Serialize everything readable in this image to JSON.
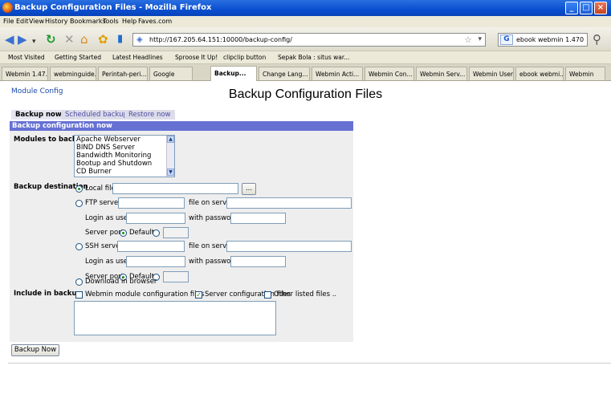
{
  "window": {
    "title": "Backup Configuration Files - Mozilla Firefox"
  },
  "menu": [
    "File",
    "Edit",
    "View",
    "History",
    "Bookmarks",
    "Tools",
    "Help",
    "Faves.com"
  ],
  "navbar": {
    "url": "http://167.205.64.151:10000/backup-config/",
    "search_value": "ebook webmin 1.470"
  },
  "bookmarks": [
    "Most Visited",
    "Getting Started",
    "Latest Headlines",
    "Sproose It Up!",
    "clipclip button",
    "Sepak Bola : situs war..."
  ],
  "tabs": [
    "Webmin 1.47...",
    "webminguide...",
    "Perintah-peri...",
    "Google",
    "Backup...",
    "Change Lang...",
    "Webmin Acti...",
    "Webmin Con...",
    "Webmin Serv...",
    "Webmin Users",
    "ebook webmi...",
    "Webmin"
  ],
  "page": {
    "module_config": "Module Config",
    "title": "Backup Configuration Files",
    "page_tabs": [
      "Backup now",
      "Scheduled backups",
      "Restore now"
    ],
    "panel_header": "Backup configuration now",
    "modules_label": "Modules to backup",
    "modules": [
      "Apache Webserver",
      "BIND DNS Server",
      "Bandwidth Monitoring",
      "Bootup and Shutdown",
      "CD Burner"
    ],
    "destination_label": "Backup destination",
    "local_file": "Local file",
    "browse": "...",
    "ftp_server": "FTP server",
    "file_on_server": "file on server",
    "login_as_user": "Login as user",
    "with_password": "with password",
    "server_port": "Server port",
    "default": "Default",
    "ssh_server": "SSH server",
    "download": "Download in browser",
    "include_label": "Include in backup",
    "include_webmin": "Webmin module configuration files",
    "include_server": "Server configuration files",
    "include_other": "Other listed files ..",
    "backup_now_button": "Backup Now"
  }
}
